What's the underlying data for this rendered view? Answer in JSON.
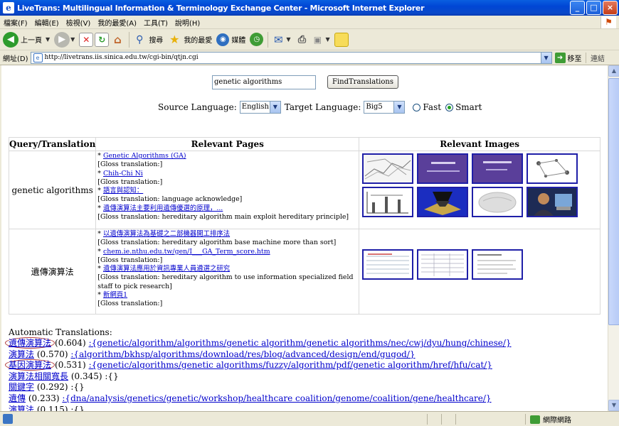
{
  "window": {
    "title": "LiveTrans: Multilingual Information & Terminology Exchange Center - Microsoft Internet Explorer",
    "controls": [
      "_",
      "□",
      "×"
    ]
  },
  "menu": [
    "檔案(F)",
    "編輯(E)",
    "檢視(V)",
    "我的最愛(A)",
    "工具(T)",
    "說明(H)"
  ],
  "toolbar": {
    "back_label": "上一頁",
    "search_label": "搜尋",
    "favorites_label": "我的最愛",
    "media_label": "媒體"
  },
  "address": {
    "label": "網址(D)",
    "url": "http://livetrans.iis.sinica.edu.tw/cgi-bin/qtjn.cgi",
    "go_label": "移至",
    "links_label": "連結"
  },
  "search": {
    "query": "genetic algorithms",
    "button_label": "FindTranslations",
    "source_label": "Source Language:",
    "source_value": "English",
    "target_label": "Target Language:",
    "target_value": "Big5",
    "fast_label": "Fast",
    "smart_label": "Smart",
    "selected_mode": "smart"
  },
  "results": {
    "headers": [
      "Query/Translation",
      "Relevant Pages",
      "Relevant Images"
    ],
    "rows": [
      {
        "query": "genetic algorithms",
        "pages": [
          {
            "link": "Genetic Algorithms (GA)",
            "gloss": "[Gloss translation:]"
          },
          {
            "link": "Chih-Chi Ni",
            "gloss": "[Gloss translation:]"
          },
          {
            "link": "語言與認知：",
            "gloss": "[Gloss translation: language acknowledge]"
          },
          {
            "link": "遺傳演算法主要利用遺傳優選的原理，...",
            "gloss": "[Gloss translation: hereditary algorithm main exploit hereditary principle]"
          }
        ],
        "image_count": 8
      },
      {
        "query": "遺傳演算法",
        "pages": [
          {
            "link": "以遺傳演算法為基礎之二部機器開工排序法",
            "gloss": "[Gloss translation: hereditary algorithm base machine more than sort]"
          },
          {
            "link": "chem.ie.nthu.edu.tw/gen/I___GA_Term_score.htm",
            "gloss": "[Gloss translation:]"
          },
          {
            "link": "遺傳演算法應用於資訊專業人員遴選之研究",
            "gloss": "[Gloss translation: hereditary algorithm to use information specialized field staff to pick research]"
          },
          {
            "link": "新網頁1",
            "gloss": "[Gloss translation:]"
          }
        ],
        "image_count": 3
      }
    ]
  },
  "auto": {
    "heading": "Automatic Translations:",
    "items": [
      {
        "term": "遺傳演算法",
        "score": "(0.604)",
        "sources": ":{genetic/algorithm/algorithms/genetic algorithm/genetic algorithms/nec/cwj/dyu/hung/chinese/}",
        "circled": true
      },
      {
        "term": "演算法",
        "score": "(0.570)",
        "sources": ":{algorithm/bkhsp/algorithms/download/res/blog/advanced/design/end/gugod/}",
        "circled": false
      },
      {
        "term": "基因演算法",
        "score": "(0.531)",
        "sources": ":{genetic/algorithms/genetic algorithms/fuzzy/algorithm/pdf/genetic algorithm/href/hfu/cat/}",
        "circled": true
      },
      {
        "term": "演算法相關寬長",
        "score": "(0.345)",
        "sources": ":{}",
        "circled": false
      },
      {
        "term": "關鍵字",
        "score": "(0.292)",
        "sources": ":{}",
        "circled": false
      },
      {
        "term": "遺傳",
        "score": "(0.233)",
        "sources": ":{dna/analysis/genetics/genetic/workshop/healthcare coalition/genome/coalition/gene/healthcare/}",
        "circled": false
      },
      {
        "term": "演算法",
        "score": "(0.115)",
        "sources": ":{}",
        "circled": false
      }
    ]
  },
  "status": {
    "zone": "網際網路"
  },
  "colors": {
    "link": "#0000cc",
    "circle": "#b03a3a",
    "thumb_border": "#1f1fa8"
  }
}
